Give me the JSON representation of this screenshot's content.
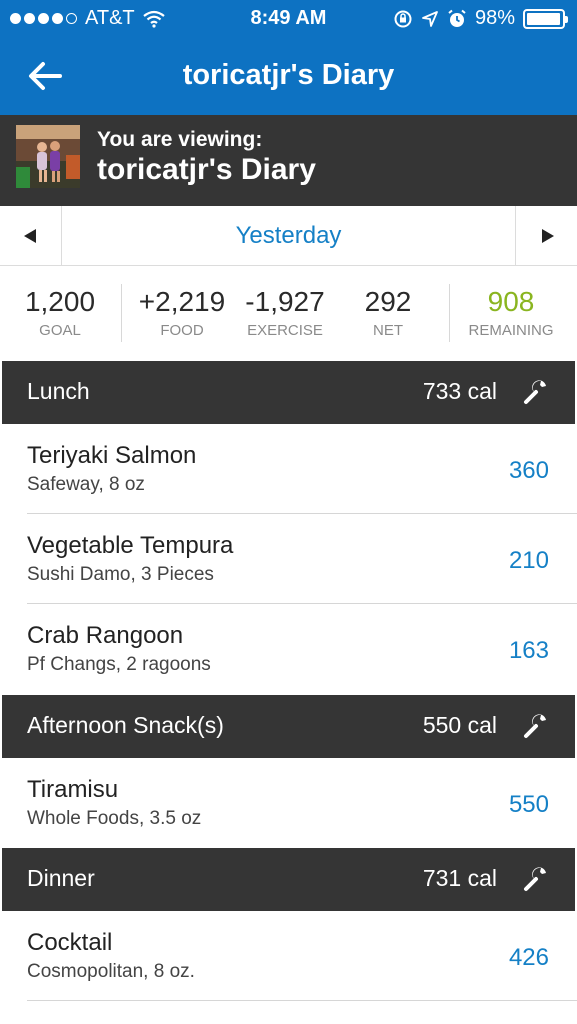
{
  "status_bar": {
    "carrier": "AT&T",
    "time": "8:49 AM",
    "battery": "98%",
    "signal_icon": "signal-dots-icon",
    "wifi_icon": "wifi-icon",
    "battery_level": 0.98
  },
  "header": {
    "title": "toricatjr's Diary",
    "back_icon": "back-arrow-icon"
  },
  "viewing": {
    "label": "You are viewing:",
    "name": "toricatjr's Diary"
  },
  "date_nav": {
    "date": "Yesterday",
    "prev_icon": "triangle-left-icon",
    "next_icon": "triangle-right-icon"
  },
  "summary": {
    "goal": {
      "value": "1,200",
      "label": "GOAL"
    },
    "food": {
      "value": "+2,219",
      "label": "FOOD"
    },
    "exercise": {
      "value": "-1,927",
      "label": "EXERCISE"
    },
    "net": {
      "value": "292",
      "label": "NET"
    },
    "remaining": {
      "value": "908",
      "label": "REMAINING"
    }
  },
  "meals": [
    {
      "name": "Lunch",
      "calories": "733 cal",
      "items": [
        {
          "name": "Teriyaki Salmon",
          "desc": "Safeway, 8 oz",
          "cal": "360"
        },
        {
          "name": "Vegetable Tempura",
          "desc": "Sushi Damo, 3 Pieces",
          "cal": "210"
        },
        {
          "name": "Crab Rangoon",
          "desc": "Pf Changs, 2 ragoons",
          "cal": "163"
        }
      ]
    },
    {
      "name": "Afternoon Snack(s)",
      "calories": "550 cal",
      "items": [
        {
          "name": "Tiramisu",
          "desc": "Whole Foods, 3.5 oz",
          "cal": "550"
        }
      ]
    },
    {
      "name": "Dinner",
      "calories": "731 cal",
      "items": [
        {
          "name": "Cocktail",
          "desc": "Cosmopolitan, 8 oz.",
          "cal": "426"
        }
      ]
    }
  ],
  "colors": {
    "brand_blue": "#0d72c2",
    "dark_bar": "#353535",
    "link_blue": "#1580c6",
    "remaining_green": "#8ab520"
  }
}
